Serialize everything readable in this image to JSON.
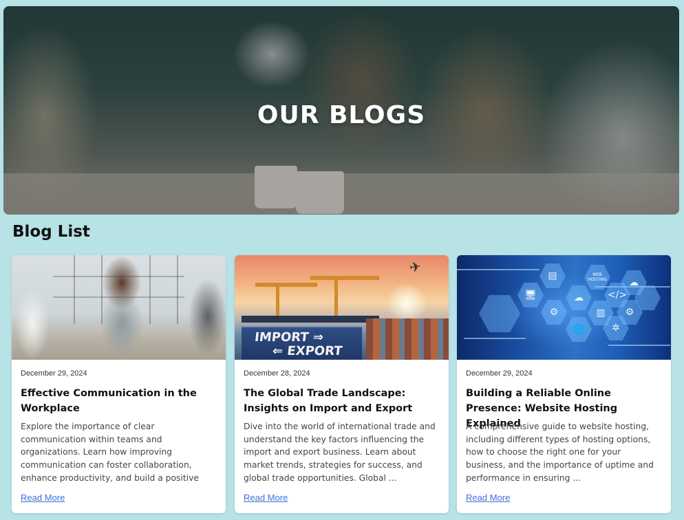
{
  "hero": {
    "title": "OUR BLOGS"
  },
  "section": {
    "title": "Blog List"
  },
  "posts": [
    {
      "date": "December 29, 2024",
      "title": "Effective Communication in the Workplace",
      "excerpt": "Explore the importance of clear communication within teams and organizations. Learn how improving communication can foster collaboration, enhance productivity, and build a positive work culture. In today's fast-paced business world, ...",
      "link": "Read More"
    },
    {
      "date": "December 28, 2024",
      "title": "The Global Trade Landscape: Insights on Import and Export",
      "excerpt": "Dive into the world of international trade and understand the key factors influencing the import and export business. Learn about market trends, strategies for success, and global trade opportunities. Global ...",
      "link": "Read More",
      "image_text": {
        "line1": "IMPORT ⇒",
        "line2": "⇐ EXPORT"
      }
    },
    {
      "date": "December 29, 2024",
      "title": "Building a Reliable Online Presence: Website Hosting Explained",
      "excerpt": "A comprehensive guide to website hosting, including different types of hosting options, how to choose the right one for your business, and the importance of uptime and performance in ensuring ...",
      "link": "Read More",
      "image_text": {
        "hex_label": "WEB HOSTING"
      }
    }
  ],
  "colors": {
    "page_background": "#b7e2e6",
    "link": "#3b6fd9"
  }
}
